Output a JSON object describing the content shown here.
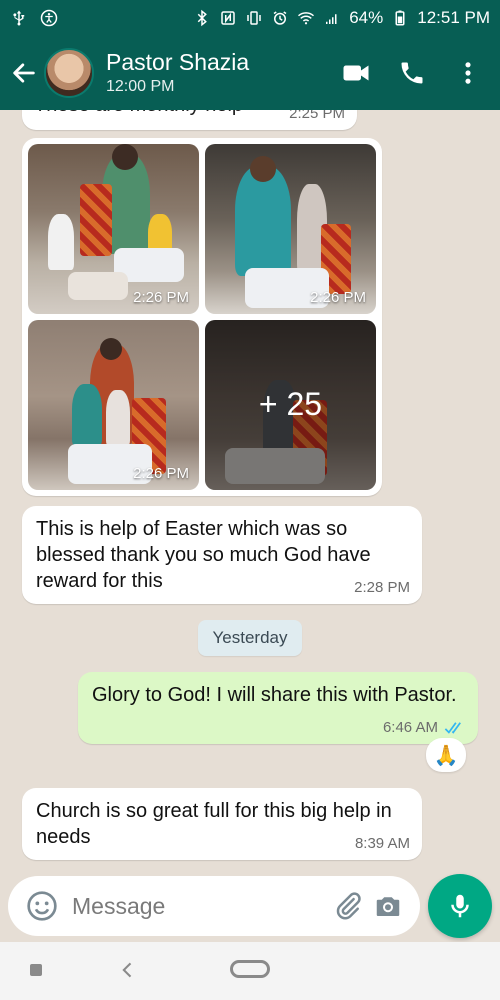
{
  "status_bar": {
    "battery": "64%",
    "time": "12:51 PM"
  },
  "header": {
    "contact_name": "Pastor Shazia",
    "subtitle": "12:00 PM"
  },
  "messages": {
    "partial_text": "These are monthly help",
    "partial_time": "2:25 PM",
    "album": {
      "times": [
        "2:26 PM",
        "2:26 PM",
        "2:26 PM"
      ],
      "more_count": "+ 25"
    },
    "msg1": {
      "text": "This is help of Easter which was so blessed thank you so much God have reward for this",
      "time": "2:28 PM"
    },
    "date_chip": "Yesterday",
    "msg2": {
      "text": "Glory to God! I will share this with Pastor.",
      "time": "6:46 AM",
      "reaction": "🙏"
    },
    "msg3": {
      "text": "Church is so great full for this big help in needs",
      "time": "8:39 AM"
    }
  },
  "input": {
    "placeholder": "Message"
  },
  "colors": {
    "header": "#075e54",
    "mic": "#00a884",
    "outgoing": "#dcf8c6",
    "ticks": "#34b7f1"
  }
}
